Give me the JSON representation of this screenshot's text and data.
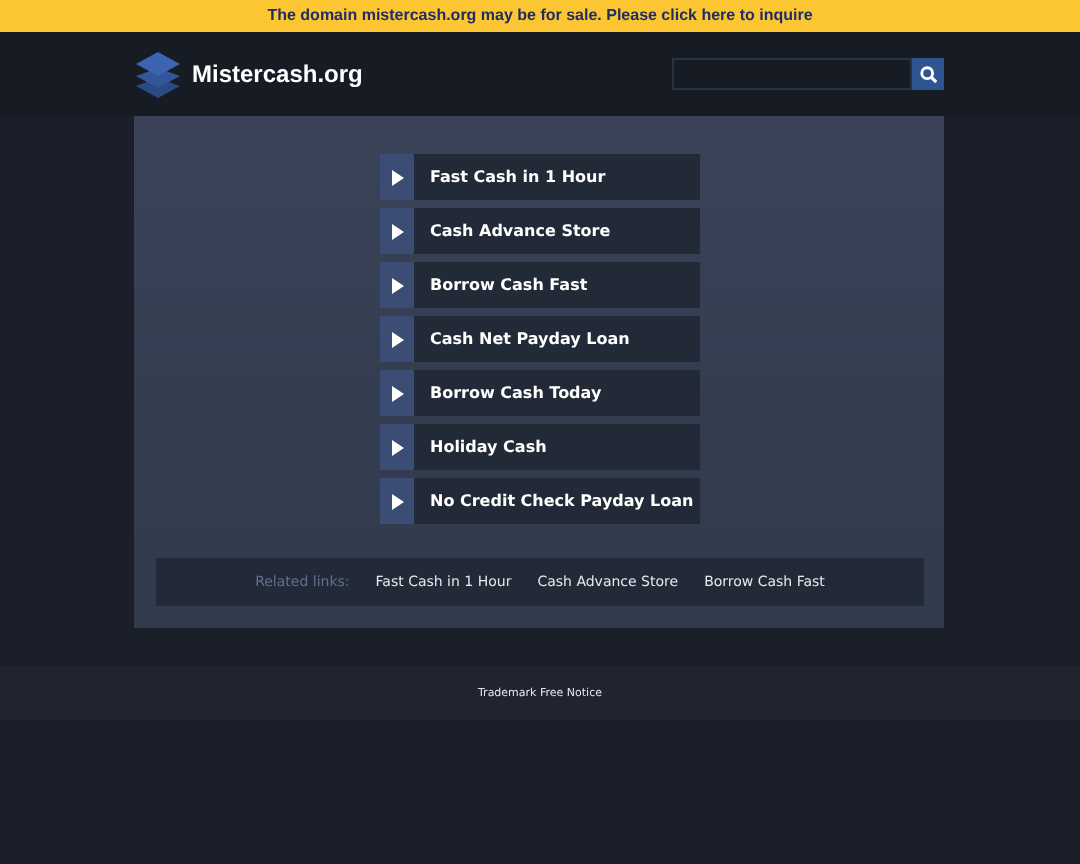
{
  "banner": {
    "text": "The domain mistercash.org may be for sale. Please click here to inquire"
  },
  "header": {
    "site_name": "Mistercash.org"
  },
  "links": [
    {
      "label": "Fast Cash in 1 Hour"
    },
    {
      "label": "Cash Advance Store"
    },
    {
      "label": "Borrow Cash Fast"
    },
    {
      "label": "Cash Net Payday Loan"
    },
    {
      "label": "Borrow Cash Today"
    },
    {
      "label": "Holiday Cash"
    },
    {
      "label": "No Credit Check Payday Loan"
    }
  ],
  "related": {
    "label": "Related links:",
    "links": [
      "Fast Cash in 1 Hour",
      "Cash Advance Store",
      "Borrow Cash Fast"
    ]
  },
  "footer": {
    "link": "Trademark Free Notice"
  }
}
